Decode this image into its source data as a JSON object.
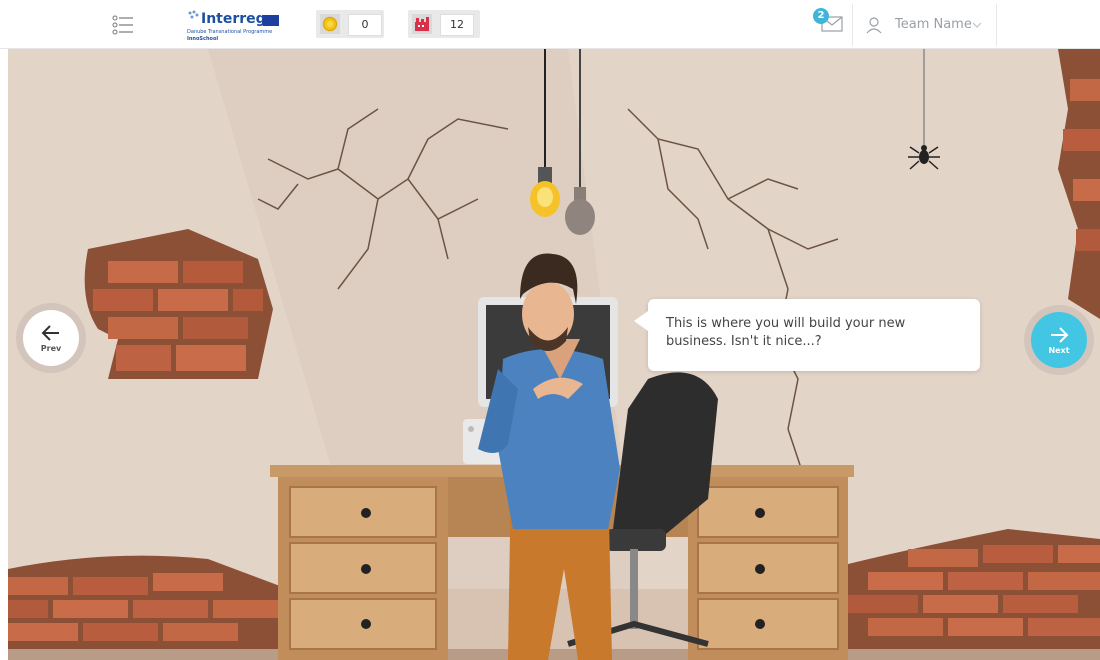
{
  "header": {
    "logo": {
      "name": "Interreg",
      "sub_line1": "Danube Transnational Programme",
      "sub_line2": "InnoSchool"
    },
    "counters": [
      {
        "icon": "sun-coin-icon",
        "value": "0"
      },
      {
        "icon": "factory-icon",
        "value": "12"
      }
    ],
    "mail": {
      "badge": "2"
    },
    "team": {
      "name": "Team Name"
    }
  },
  "scene": {
    "speech": "This is where you will build your new business. Isn't it nice...?"
  },
  "nav": {
    "prev_label": "Prev",
    "next_label": "Next"
  },
  "colors": {
    "accent": "#43c6e3",
    "wall": "#e3d3c6",
    "brick": "#b8593c",
    "desk": "#d2a26e"
  }
}
